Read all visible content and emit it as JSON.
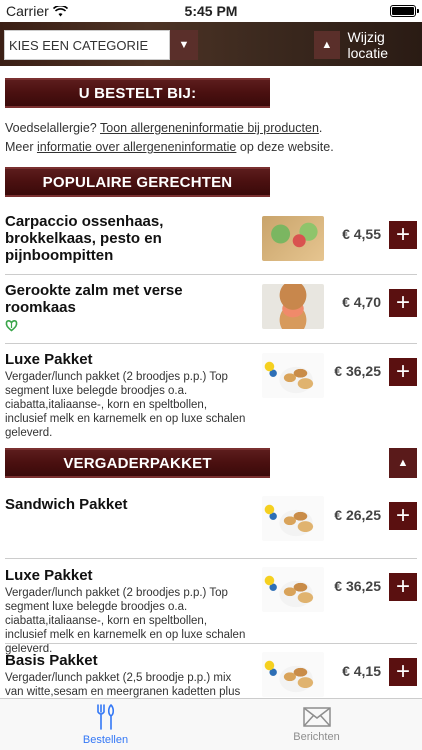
{
  "status": {
    "carrier": "Carrier",
    "time": "5:45 PM"
  },
  "topbar": {
    "category_label": "KIES EEN CATEGORIE",
    "location_label": "Wijzig locatie"
  },
  "order_header": "U BESTELT BIJ:",
  "allergy": {
    "line1_prefix": "Voedselallergie?",
    "line1_link": "Toon allergeneninformatie bij producten",
    "line1_suffix": ".",
    "line2_prefix": "Meer",
    "line2_link": "informatie over allergeneninformatie",
    "line2_suffix": "op deze website."
  },
  "sections": [
    {
      "title": "POPULAIRE GERECHTEN",
      "items": [
        {
          "title": "Carpaccio ossenhaas, brokkelkaas, pesto en pijnboompitten",
          "price": "€ 4,55",
          "thumb": "salad"
        },
        {
          "title": "Gerookte zalm met verse roomkaas",
          "price": "€ 4,70",
          "thumb": "salmon",
          "vegetarian_icon": "leaf-heart-icon"
        },
        {
          "title": "Luxe Pakket",
          "description": "Vergader/lunch pakket (2 broodjes p.p.) Top segment luxe belegde broodjes o.a. ciabatta,italiaanse-, korn en speltbollen, inclusief melk en karnemelk en op luxe schalen geleverd.",
          "price": "€ 36,25",
          "thumb": "pack"
        }
      ]
    },
    {
      "title": "VERGADERPAKKET",
      "items": [
        {
          "title": "Sandwich Pakket",
          "price": "€ 26,25",
          "thumb": "pack"
        },
        {
          "title": "Luxe Pakket",
          "description": "Vergader/lunch pakket (2 broodjes p.p.) Top segment luxe belegde broodjes o.a. ciabatta,italiaanse-, korn en speltbollen, inclusief melk en karnemelk en op luxe schalen geleverd.",
          "price": "€ 36,25",
          "thumb": "pack"
        },
        {
          "title": "Basis Pakket",
          "description": "Vergader/lunch pakket (2,5 broodje p.p.) mix van witte,sesam en meergranen kadetten plus aantal krentenbollen, inclusief zuivel en op luxe schalen",
          "price": "€ 4,15",
          "thumb": "pack"
        }
      ]
    }
  ],
  "add_symbol": "+",
  "tabs": [
    {
      "label": "Bestellen",
      "icon": "fork-knife-icon"
    },
    {
      "label": "Berichten",
      "icon": "envelope-icon"
    }
  ],
  "colors": {
    "accent": "#5a1010",
    "tab_active": "#3478f6"
  }
}
